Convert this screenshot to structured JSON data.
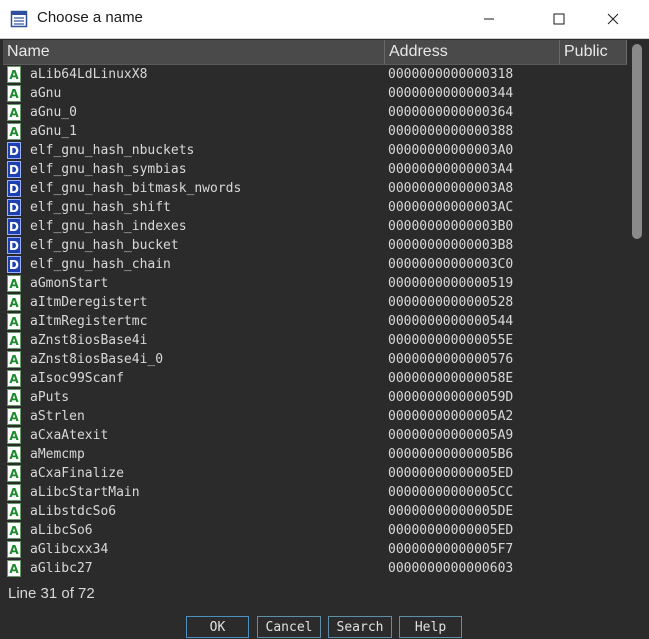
{
  "window": {
    "title": "Choose a name"
  },
  "columns": {
    "name": "Name",
    "address": "Address",
    "public": "Public"
  },
  "rows": [
    {
      "icon": "A",
      "name": "aLib64LdLinuxX8",
      "address": "0000000000000318"
    },
    {
      "icon": "A",
      "name": "aGnu",
      "address": "0000000000000344"
    },
    {
      "icon": "A",
      "name": "aGnu_0",
      "address": "0000000000000364"
    },
    {
      "icon": "A",
      "name": "aGnu_1",
      "address": "0000000000000388"
    },
    {
      "icon": "D",
      "name": "elf_gnu_hash_nbuckets",
      "address": "00000000000003A0"
    },
    {
      "icon": "D",
      "name": "elf_gnu_hash_symbias",
      "address": "00000000000003A4"
    },
    {
      "icon": "D",
      "name": "elf_gnu_hash_bitmask_nwords",
      "address": "00000000000003A8"
    },
    {
      "icon": "D",
      "name": "elf_gnu_hash_shift",
      "address": "00000000000003AC"
    },
    {
      "icon": "D",
      "name": "elf_gnu_hash_indexes",
      "address": "00000000000003B0"
    },
    {
      "icon": "D",
      "name": "elf_gnu_hash_bucket",
      "address": "00000000000003B8"
    },
    {
      "icon": "D",
      "name": "elf_gnu_hash_chain",
      "address": "00000000000003C0"
    },
    {
      "icon": "A",
      "name": "aGmonStart",
      "address": "0000000000000519"
    },
    {
      "icon": "A",
      "name": "aItmDeregistert",
      "address": "0000000000000528"
    },
    {
      "icon": "A",
      "name": "aItmRegistertmc",
      "address": "0000000000000544"
    },
    {
      "icon": "A",
      "name": "aZnst8iosBase4i",
      "address": "000000000000055E"
    },
    {
      "icon": "A",
      "name": "aZnst8iosBase4i_0",
      "address": "0000000000000576"
    },
    {
      "icon": "A",
      "name": "aIsoc99Scanf",
      "address": "000000000000058E"
    },
    {
      "icon": "A",
      "name": "aPuts",
      "address": "000000000000059D"
    },
    {
      "icon": "A",
      "name": "aStrlen",
      "address": "00000000000005A2"
    },
    {
      "icon": "A",
      "name": "aCxaAtexit",
      "address": "00000000000005A9"
    },
    {
      "icon": "A",
      "name": "aMemcmp",
      "address": "00000000000005B6"
    },
    {
      "icon": "A",
      "name": "aCxaFinalize",
      "address": "00000000000005ED"
    },
    {
      "icon": "A",
      "name": "aLibcStartMain",
      "address": "00000000000005CC"
    },
    {
      "icon": "A",
      "name": "aLibstdcSo6",
      "address": "00000000000005DE"
    },
    {
      "icon": "A",
      "name": "aLibcSo6",
      "address": "00000000000005ED"
    },
    {
      "icon": "A",
      "name": "aGlibcxx34",
      "address": "00000000000005F7"
    },
    {
      "icon": "A",
      "name": "aGlibc27",
      "address": "0000000000000603"
    }
  ],
  "status": "Line 31 of 72",
  "buttons": {
    "ok": "OK",
    "cancel": "Cancel",
    "search": "Search",
    "help": "Help"
  },
  "icons": {
    "app": "window-list-icon",
    "minimize": "minimize-icon",
    "maximize": "maximize-icon",
    "close": "close-icon"
  },
  "colors": {
    "background": "#2b2b2b",
    "header": "#4a4a4a",
    "text": "#d8d8d8",
    "button_border": "#5f8fa8"
  }
}
